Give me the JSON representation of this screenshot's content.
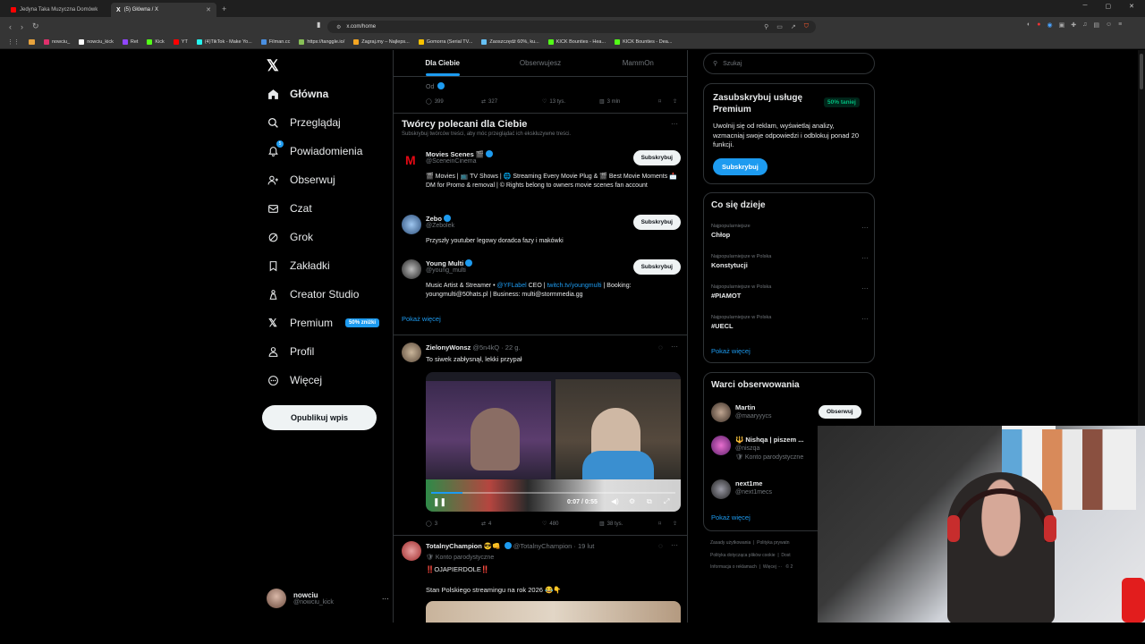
{
  "browser": {
    "tabs": [
      {
        "title": "Jedyna Taka Muzyczna Domówk",
        "fav_color": "#ff0000",
        "active": false
      },
      {
        "title": "(5) Główna / X",
        "fav_color": "#ffffff",
        "active": true
      }
    ],
    "new_tab": "+",
    "url": "x.com/home",
    "bookmarks": [
      {
        "label": "nowciu_",
        "color": "#e1306c"
      },
      {
        "label": "nowciu_kick",
        "color": "#ffffff"
      },
      {
        "label": "Ret",
        "color": "#9146ff"
      },
      {
        "label": "Kick",
        "color": "#53fc18"
      },
      {
        "label": "YT",
        "color": "#ff0000"
      },
      {
        "label": "(4)TikTok - Make Yo...",
        "color": "#25f4ee"
      },
      {
        "label": "Filman.cc",
        "color": "#4a90e2"
      },
      {
        "label": "https://tanggle.io/",
        "color": "#88c057"
      },
      {
        "label": "Zagraj.my – Najleps...",
        "color": "#f5a623"
      },
      {
        "label": "Gomorra (Serial TV...",
        "color": "#f8c200"
      },
      {
        "label": "Zaoszczędź 60%, ku...",
        "color": "#66c0f4"
      },
      {
        "label": "KICK Bounties - Hea...",
        "color": "#53fc18"
      },
      {
        "label": "KICK Bounties - Dea...",
        "color": "#53fc18"
      }
    ]
  },
  "nav": {
    "items": [
      {
        "label": "Główna",
        "icon": "home-icon",
        "glyph": "⌂",
        "selected": true
      },
      {
        "label": "Przeglądaj",
        "icon": "search-icon",
        "glyph": "⚲",
        "selected": false
      },
      {
        "label": "Powiadomienia",
        "icon": "bell-icon",
        "glyph": "🔔",
        "selected": false
      },
      {
        "label": "Obserwuj",
        "icon": "follow-icon",
        "glyph": "👤",
        "selected": false
      },
      {
        "label": "Czat",
        "icon": "mail-icon",
        "glyph": "✉",
        "selected": false
      },
      {
        "label": "Grok",
        "icon": "grok-icon",
        "glyph": "⊘",
        "selected": false
      },
      {
        "label": "Zakładki",
        "icon": "bookmark-icon",
        "glyph": "🔖",
        "selected": false
      },
      {
        "label": "Creator Studio",
        "icon": "creator-studio-icon",
        "glyph": "♙",
        "selected": false
      },
      {
        "label": "Premium",
        "icon": "x-icon",
        "glyph": "X",
        "selected": false,
        "badge": "50% zniżki"
      },
      {
        "label": "Profil",
        "icon": "profile-icon",
        "glyph": "♙",
        "selected": false
      },
      {
        "label": "Więcej",
        "icon": "more-icon",
        "glyph": "⋯",
        "selected": false
      }
    ],
    "notifications_count": "5",
    "post_button": "Opublikuj wpis",
    "account": {
      "name": "nowciu",
      "handle": "@nowciu_kick",
      "more": "···"
    }
  },
  "feed": {
    "tabs": [
      "Dla Ciebie",
      "Obserwujesz",
      "MammOn"
    ],
    "top_post": {
      "partial_text": "Od",
      "replies": "399",
      "reposts": "327",
      "likes": "13 tys.",
      "views": "3 mln"
    },
    "creators": {
      "title": "Twórcy polecani dla Ciebie",
      "subtitle": "Subskrybuj twórców treści, aby móc przeglądać ich ekskluzywne treści.",
      "more": "···",
      "subscribe_label": "Subskrybuj",
      "items": [
        {
          "name": "Movies Scenes 🎬",
          "handle": "@SceneinCinema",
          "bio": "🎬 Movies | 📺 TV Shows | 🌐 Streaming Every Movie Plug & 🎬 Best Movie Moments 📩 DM for Promo & removal | © Rights belong to owners movie scenes fan account",
          "avatar_color": "#d10000"
        },
        {
          "name": "Zebo",
          "handle": "@Zebolek",
          "bio": "Przyszły youtuber legowy doradca fazy i makówki",
          "avatar_color": "#3a6ea5"
        },
        {
          "name": "Young Multi",
          "handle": "@young_multi",
          "bio_pre": "Music Artist & Streamer • ",
          "bio_link1": "@YFLabel",
          "bio_mid": " CEO | ",
          "bio_link2": "twitch.tv/youngmulti",
          "bio_post": " | Booking: youngmulti@50hats.pl | Business: multi@stormmedia.gg",
          "avatar_color": "#444"
        }
      ],
      "show_more": "Pokaż więcej"
    },
    "post1": {
      "name": "ZielonyWonsz",
      "handle": "@5n4kQ",
      "time": "· 22 g.",
      "text": "To siwek zabłysnął, lekki przypał",
      "video_time": "0:07 / 0:55",
      "progress_fraction": 0.127,
      "replies": "3",
      "reposts": "4",
      "likes": "480",
      "views": "38 tys."
    },
    "post2": {
      "name": "TotalnyChampion 😎👊",
      "handle": "@TotalnyChampion",
      "time": "· 19 lut",
      "parody": "Konto parodystyczne",
      "text1": "‼️OJAPIERDOLE‼️",
      "text2": "Stan Polskiego streamingu na rok 2026 😂👇"
    }
  },
  "sidebar": {
    "search_placeholder": "Szukaj",
    "premium": {
      "title": "Zasubskrybuj usługę Premium",
      "badge": "50% taniej",
      "text": "Uwolnij się od reklam, wyświetlaj analizy, wzmacniaj swoje odpowiedzi i odblokuj ponad 20 funkcji.",
      "button": "Subskrybuj"
    },
    "trends": {
      "title": "Co się dzieje",
      "items": [
        {
          "category": "Najpopularniejsze",
          "name": "Chłop"
        },
        {
          "category": "Najpopularniejsze w Polska",
          "name": "Konstytucji"
        },
        {
          "category": "Najpopularniejsze w Polska",
          "name": "#PIAMOT"
        },
        {
          "category": "Najpopularniejsze w Polska",
          "name": "#UECL"
        }
      ],
      "show_more": "Pokaż więcej"
    },
    "who_to_follow": {
      "title": "Warci obserwowania",
      "items": [
        {
          "name": "Martin",
          "handle": "@maaryyycs",
          "button": "Obserwuj"
        },
        {
          "name": "🔱 Nishqa | piszem ...",
          "handle": "@niszqa",
          "note": "Konto parodystyczne"
        },
        {
          "name": "next1me",
          "handle": "@next1mecs"
        }
      ],
      "show_more": "Pokaż więcej"
    },
    "footer": {
      "line1": [
        "Zasady użytkowania",
        "Polityka prywatn"
      ],
      "line2": [
        "Polityka dotycząca plików cookie",
        "Dost"
      ],
      "line3": [
        "Informacja o reklamach",
        "Więcej ···",
        "© 2"
      ]
    }
  },
  "colors": {
    "accent": "#1d9bf0",
    "bg": "#000000",
    "border": "#2f3336",
    "muted": "#71767b",
    "premium_badge": "#00ba7c"
  }
}
